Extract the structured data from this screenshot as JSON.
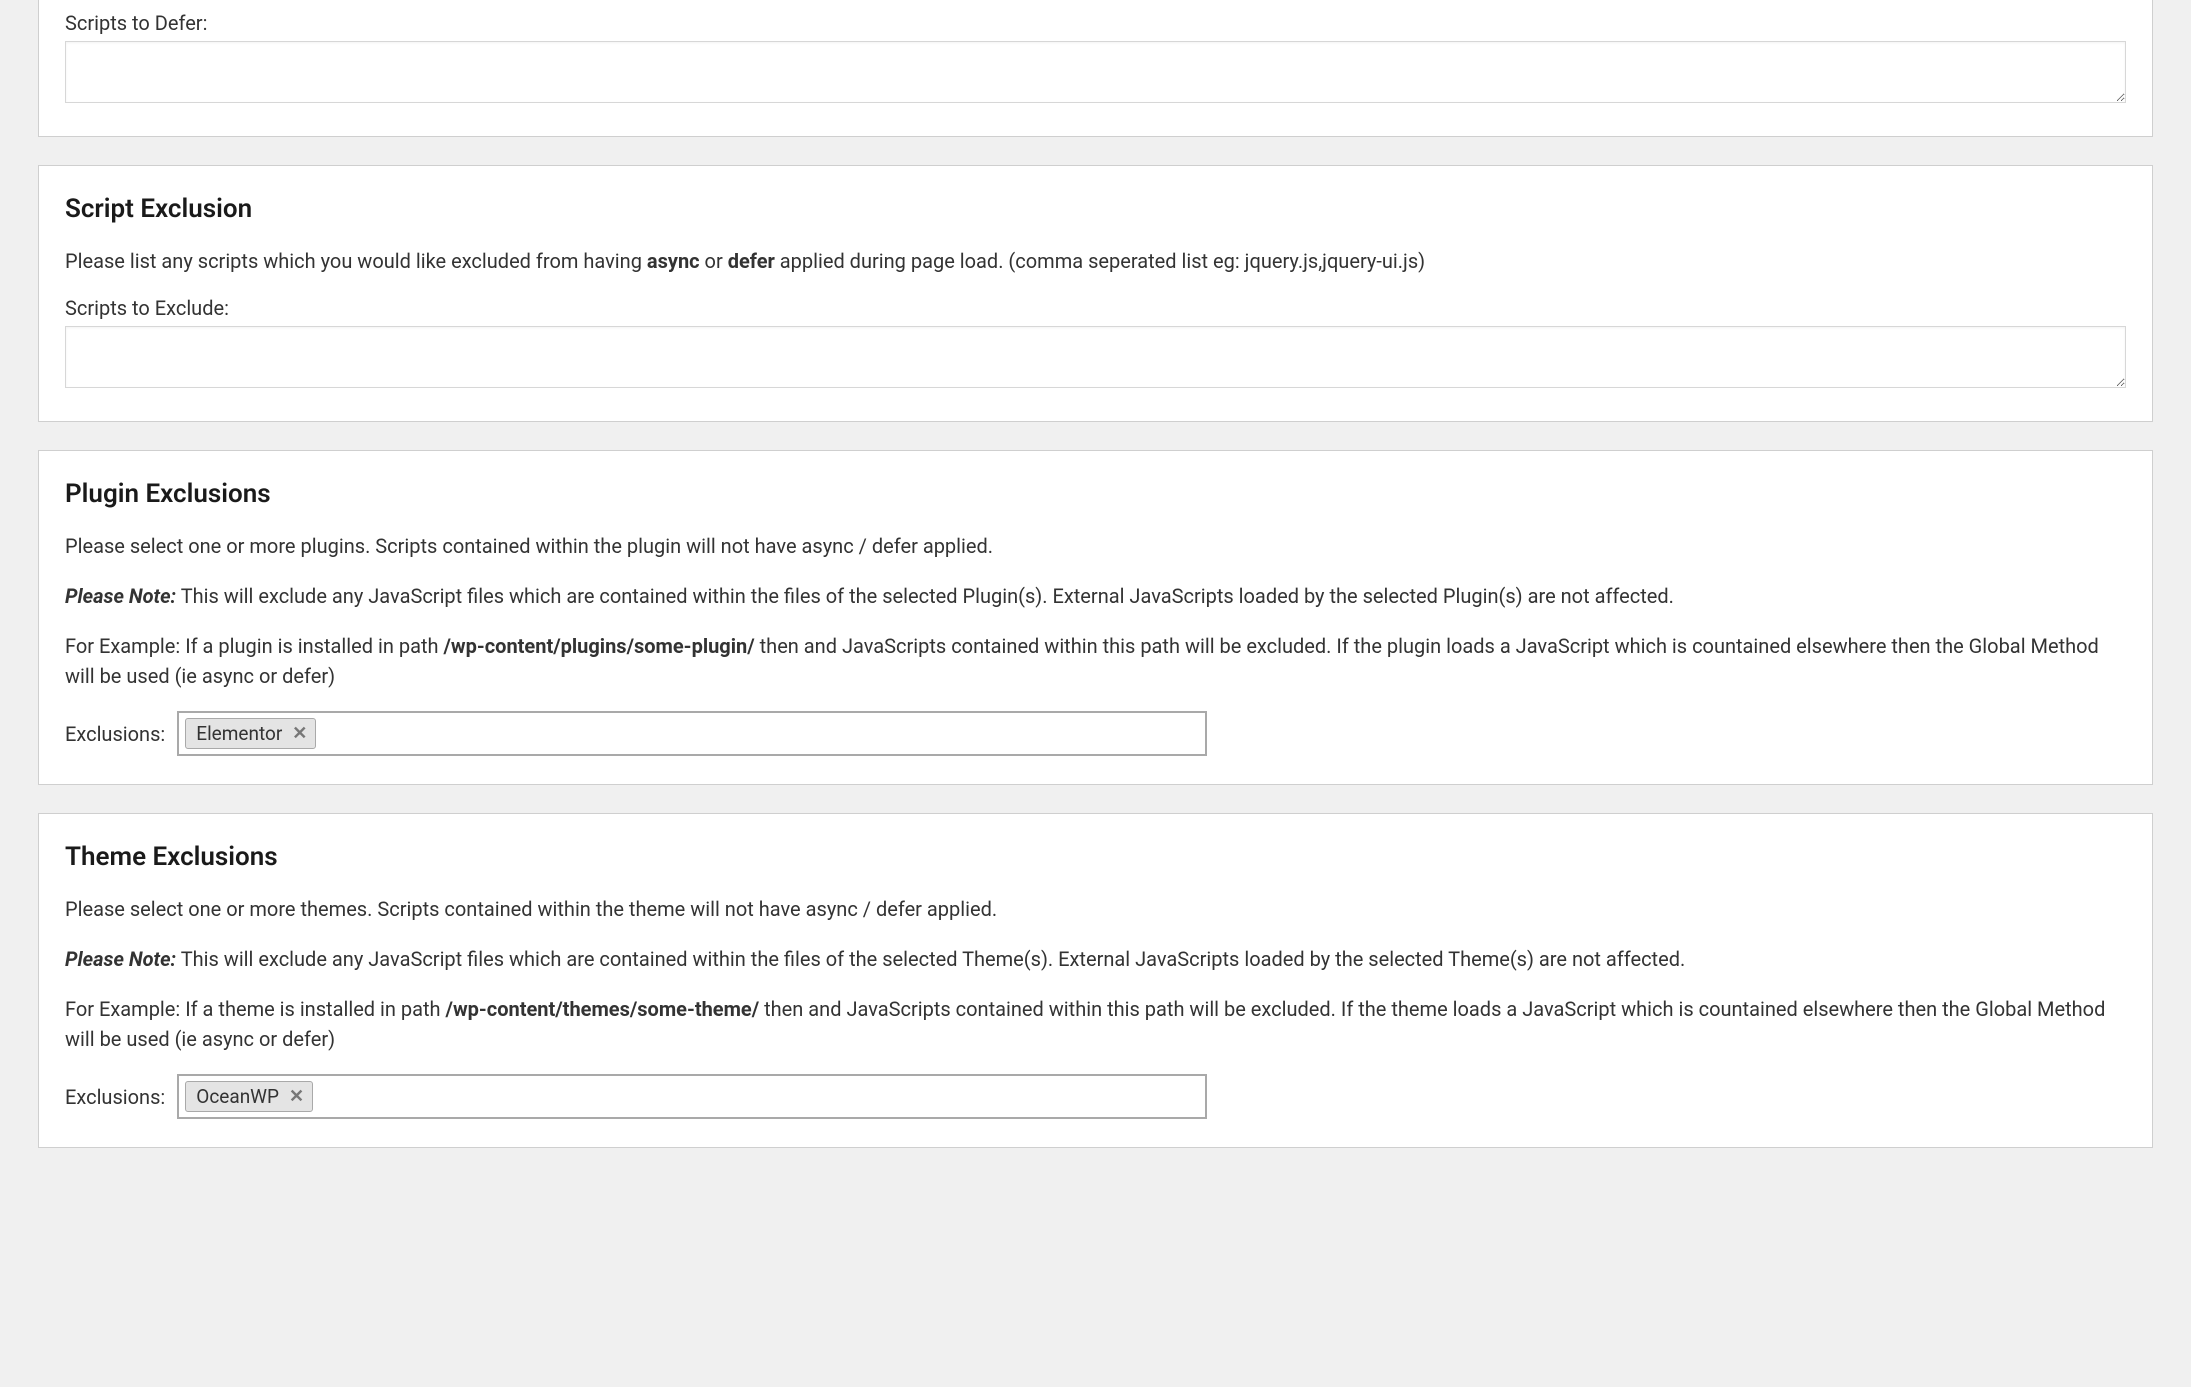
{
  "defer": {
    "label": "Scripts to Defer:",
    "value": ""
  },
  "scriptExclusion": {
    "title": "Script Exclusion",
    "desc_pre": "Please list any scripts which you would like excluded from having ",
    "desc_b1": "async",
    "desc_mid": " or ",
    "desc_b2": "defer",
    "desc_post": " applied during page load. (comma seperated list eg: jquery.js,jquery-ui.js)",
    "label": "Scripts to Exclude:",
    "value": ""
  },
  "pluginExclusions": {
    "title": "Plugin Exclusions",
    "p1": "Please select one or more plugins. Scripts contained within the plugin will not have async / defer applied.",
    "noteLabel": "Please Note:",
    "note": " This will exclude any JavaScript files which are contained within the files of the selected Plugin(s). External JavaScripts loaded by the selected Plugin(s) are not affected.",
    "ex_pre": "For Example: If a plugin is installed in path ",
    "ex_path": "/wp-content/plugins/some-plugin/",
    "ex_post": " then and JavaScripts contained within this path will be excluded. If the plugin loads a JavaScript which is countained elsewhere then the Global Method will be used (ie async or defer)",
    "fieldLabel": "Exclusions:",
    "chip": "Elementor"
  },
  "themeExclusions": {
    "title": "Theme Exclusions",
    "p1": "Please select one or more themes. Scripts contained within the theme will not have async / defer applied.",
    "noteLabel": "Please Note:",
    "note": " This will exclude any JavaScript files which are contained within the files of the selected Theme(s). External JavaScripts loaded by the selected Theme(s) are not affected.",
    "ex_pre": "For Example: If a theme is installed in path ",
    "ex_path": "/wp-content/themes/some-theme/",
    "ex_post": " then and JavaScripts contained within this path will be excluded. If the theme loads a JavaScript which is countained elsewhere then the Global Method will be used (ie async or defer)",
    "fieldLabel": "Exclusions:",
    "chip": "OceanWP"
  },
  "glyphs": {
    "remove": "✕"
  }
}
